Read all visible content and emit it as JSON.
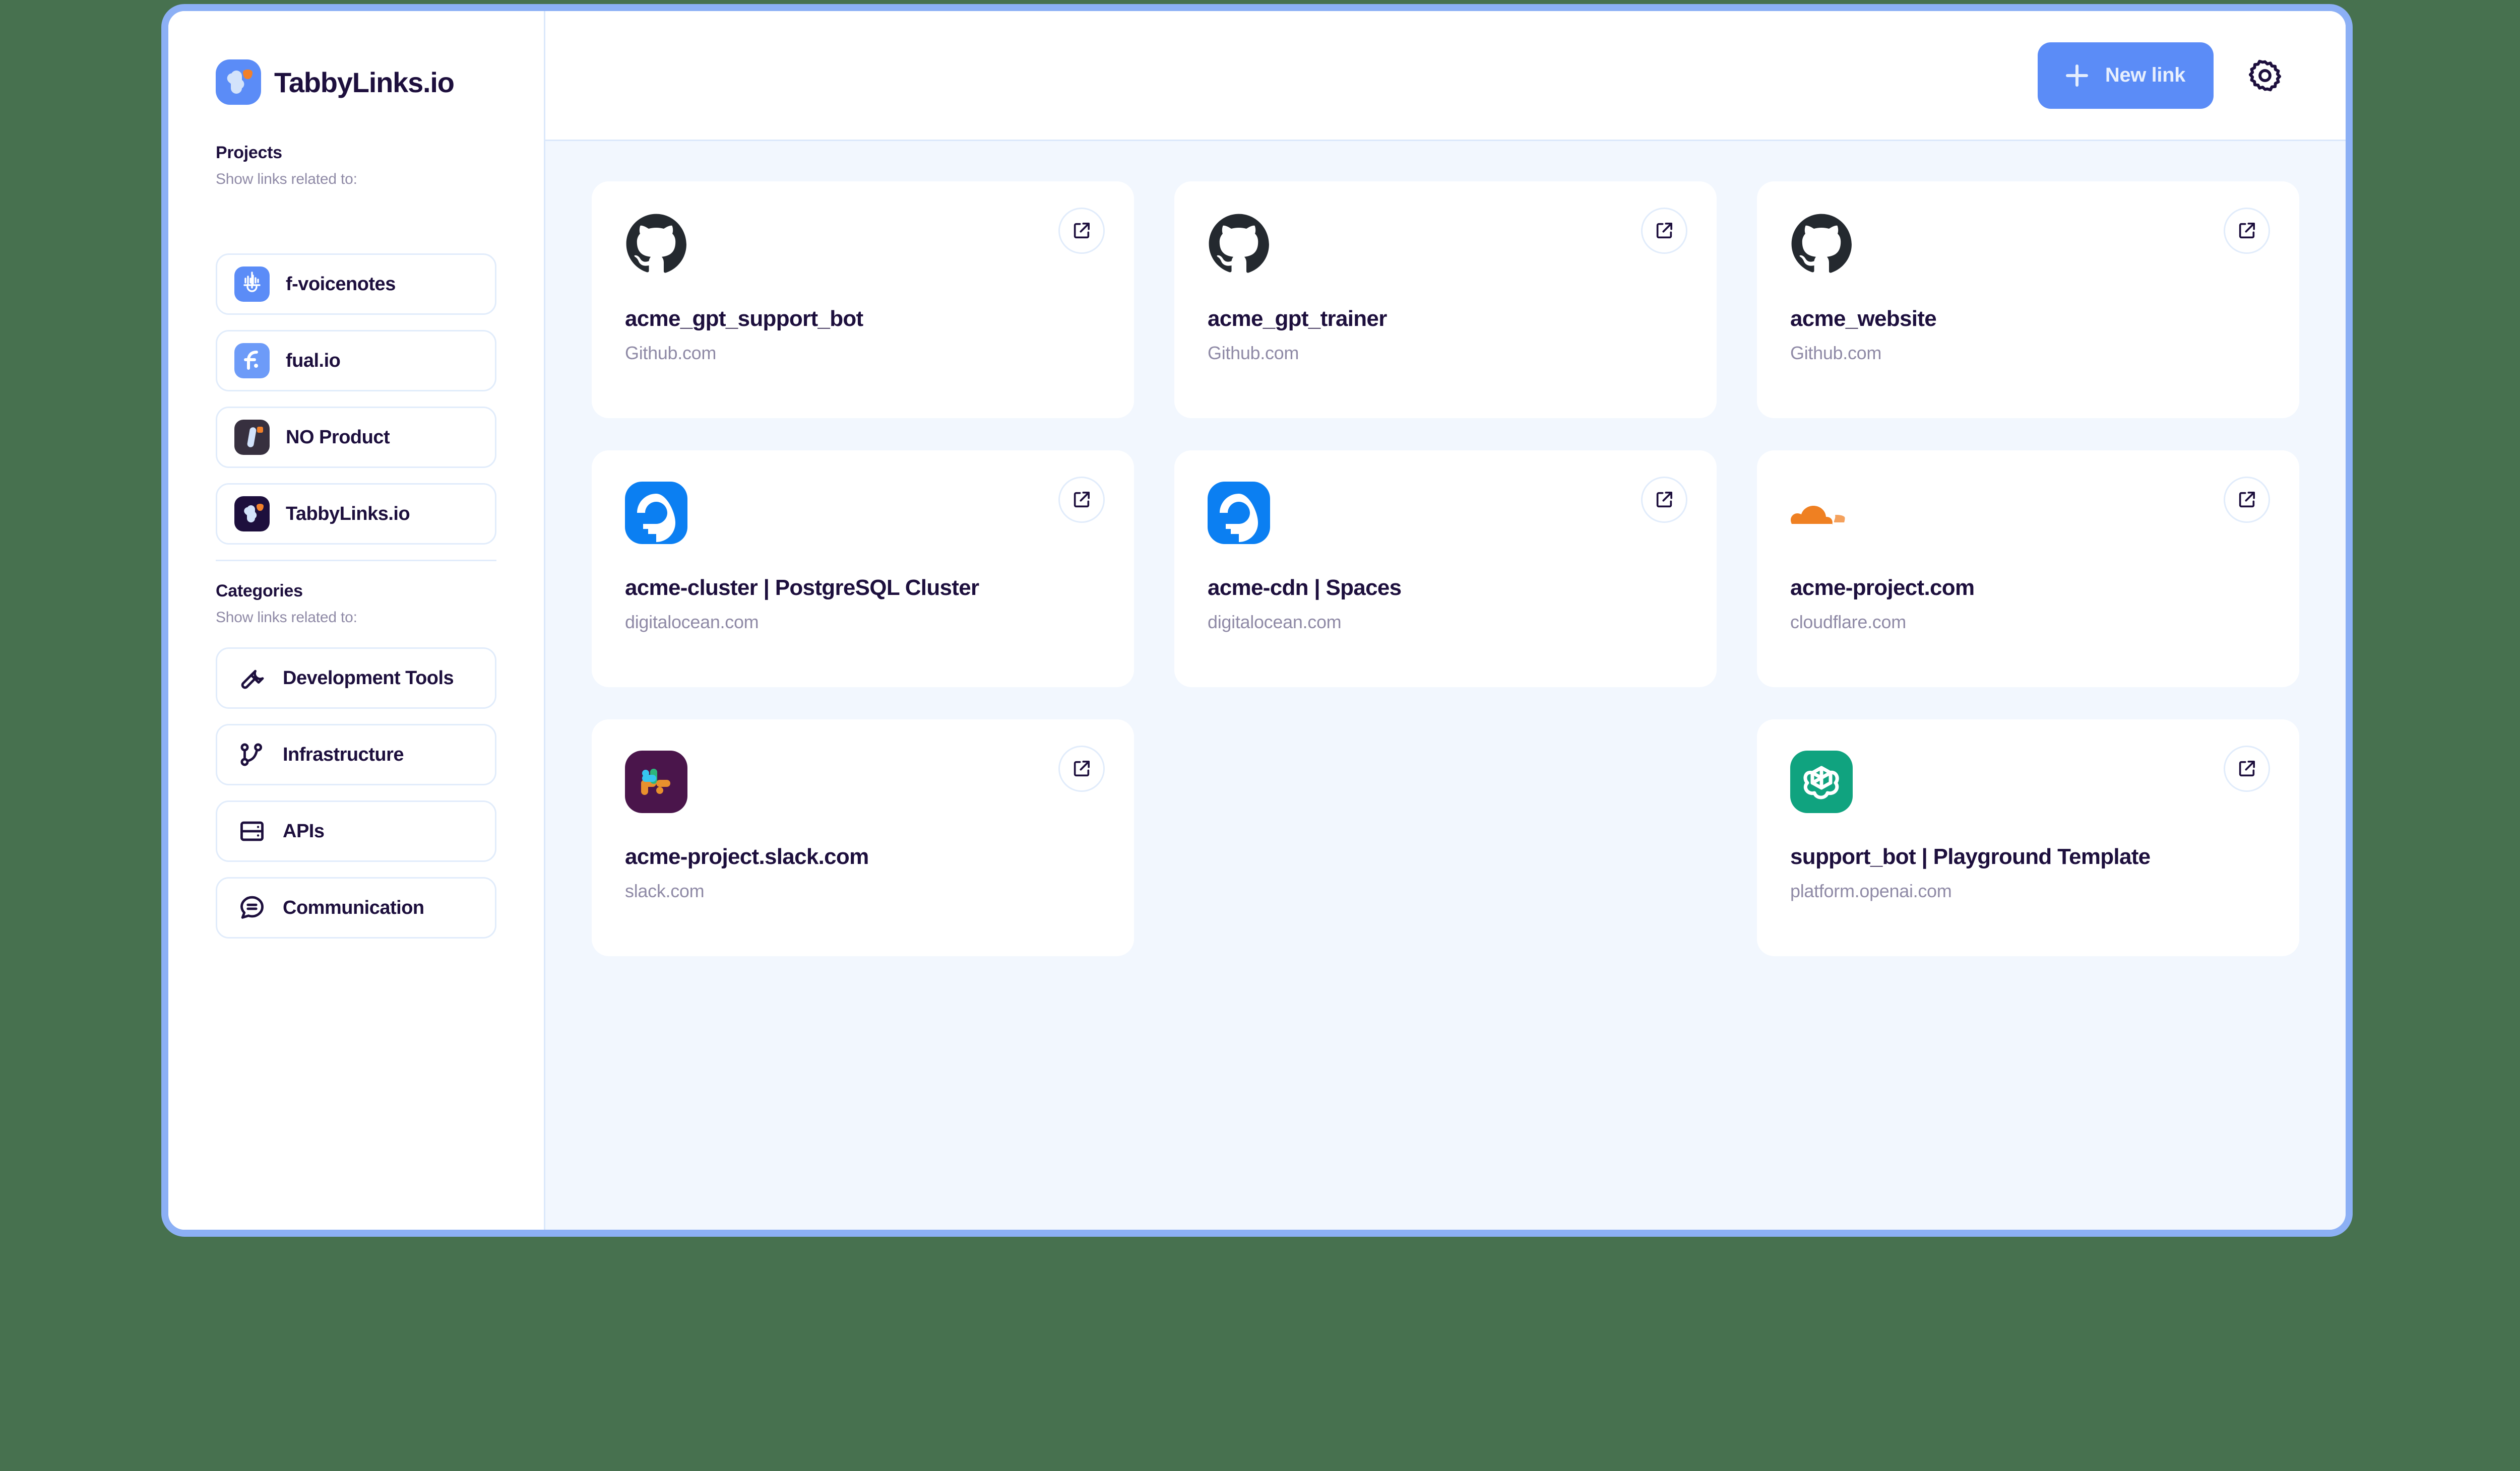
{
  "brand": {
    "name": "TabbyLinks.io",
    "logo_icon": "tabbylinks-logo-icon"
  },
  "topbar": {
    "new_link_label": "New link",
    "plus_icon": "plus-icon",
    "settings_icon": "gear-icon"
  },
  "sidebar": {
    "projects": {
      "title": "Projects",
      "subtitle": "Show links related to:",
      "items": [
        {
          "label": "f-voicenotes",
          "icon": "f-voicenotes-icon"
        },
        {
          "label": "fual.io",
          "icon": "fual-io-icon"
        },
        {
          "label": "NO Product",
          "icon": "no-product-icon"
        },
        {
          "label": "TabbyLinks.io",
          "icon": "tabbylinks-icon"
        }
      ]
    },
    "categories": {
      "title": "Categories",
      "subtitle": "Show links related to:",
      "items": [
        {
          "label": "Development Tools",
          "icon": "wrench-icon"
        },
        {
          "label": "Infrastructure",
          "icon": "git-branch-icon"
        },
        {
          "label": "APIs",
          "icon": "server-icon"
        },
        {
          "label": "Communication",
          "icon": "chat-bubble-icon"
        }
      ]
    }
  },
  "main": {
    "open_link_icon": "external-link-icon",
    "cards": [
      {
        "title": "acme_gpt_support_bot",
        "domain": "Github.com",
        "logo": "github-icon"
      },
      {
        "title": "acme_gpt_trainer",
        "domain": "Github.com",
        "logo": "github-icon"
      },
      {
        "title": "acme_website",
        "domain": "Github.com",
        "logo": "github-icon"
      },
      {
        "title": "acme-cluster | PostgreSQL Cluster",
        "domain": "digitalocean.com",
        "logo": "digitalocean-icon"
      },
      {
        "title": "acme-cdn | Spaces",
        "domain": "digitalocean.com",
        "logo": "digitalocean-icon"
      },
      {
        "title": "acme-project.com",
        "domain": "cloudflare.com",
        "logo": "cloudflare-icon"
      },
      {
        "title": "acme-project.slack.com",
        "domain": "slack.com",
        "logo": "slack-icon"
      },
      {
        "title": "",
        "domain": "",
        "logo": ""
      },
      {
        "title": "support_bot | Playground Template",
        "domain": "platform.openai.com",
        "logo": "openai-icon"
      }
    ]
  },
  "colors": {
    "page_background": "#47714f",
    "window_border": "#8cb0f5",
    "accent": "#5b8cf7",
    "text_primary": "#1d0f3d",
    "text_muted": "#8f8aa6",
    "content_background": "#f2f7fe",
    "card_border": "#e1ecfb",
    "brand_orange": "#f2802a"
  }
}
